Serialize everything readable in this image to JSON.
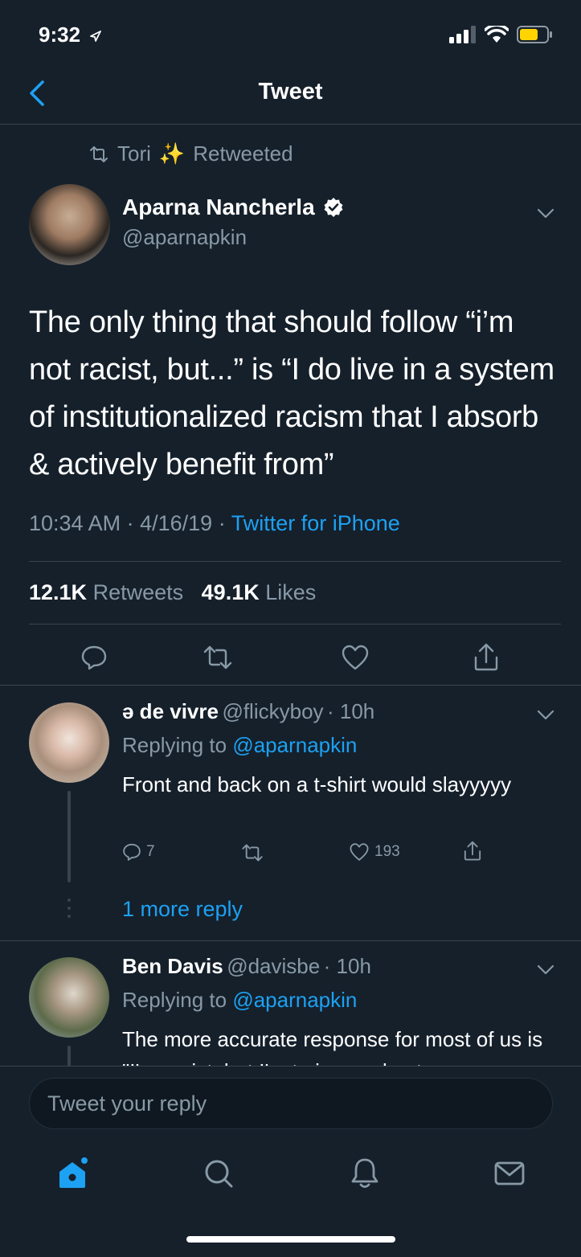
{
  "status_bar": {
    "time": "9:32"
  },
  "nav": {
    "title": "Tweet"
  },
  "retweet": {
    "by": "Tori",
    "sparkles": "✨",
    "label": "Retweeted"
  },
  "tweet": {
    "author_name": "Aparna Nancherla",
    "author_handle": "@aparnapkin",
    "text": "The only thing that should follow “i’m not racist, but...” is “I do live in a system of institutionalized racism that I absorb & actively benefit from”",
    "time": "10:34 AM",
    "date": "4/16/19",
    "sep": "·",
    "source": "Twitter for iPhone",
    "retweets_count": "12.1K",
    "retweets_label": "Retweets",
    "likes_count": "49.1K",
    "likes_label": "Likes"
  },
  "replies": [
    {
      "name": "ə de vivre",
      "handle": "@flickyboy",
      "time": "· 10h",
      "replying_label": "Replying to",
      "replying_to": "@aparnapkin",
      "text": "Front and back on a t-shirt would slayyyyy",
      "reply_count": "7",
      "like_count": "193",
      "more_replies": "1 more reply"
    },
    {
      "name": "Ben Davis",
      "handle": "@davisbe",
      "time": "· 10h",
      "replying_label": "Replying to",
      "replying_to": "@aparnapkin",
      "text": "The more accurate response for most of us is \"I'm racist, but I'm trying my best"
    }
  ],
  "composer": {
    "placeholder": "Tweet your reply"
  },
  "colors": {
    "background": "#15202b",
    "accent": "#1da1f2",
    "muted": "#8899a6",
    "divider": "#38444d"
  },
  "icons": [
    "back-icon",
    "retweet-icon",
    "verified-icon",
    "chevron-down-icon",
    "reply-icon",
    "like-icon",
    "share-icon",
    "home-icon",
    "search-icon",
    "notifications-icon",
    "messages-icon"
  ]
}
